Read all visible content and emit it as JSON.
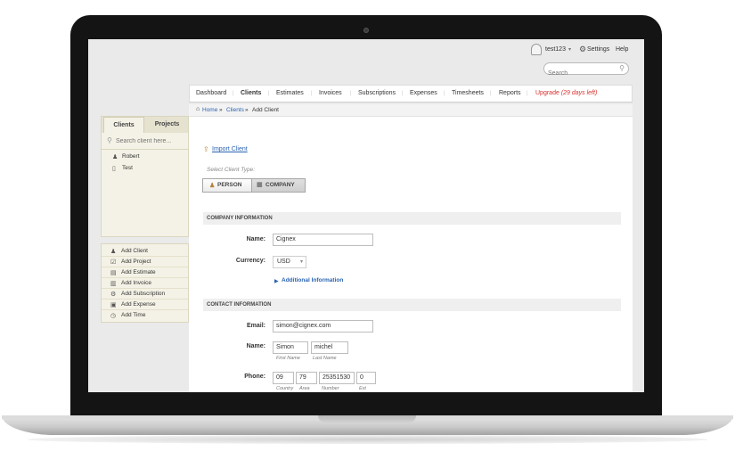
{
  "header": {
    "username": "test123",
    "settings_label": "Settings",
    "help_label": "Help",
    "search_placeholder": "Search"
  },
  "nav": {
    "items": [
      "Dashboard",
      "Clients",
      "Estimates",
      "Invoices",
      "Subscriptions",
      "Expenses",
      "Timesheets",
      "Reports"
    ],
    "active": "Clients",
    "upgrade_label": "Upgrade",
    "upgrade_note": "(29 days left)"
  },
  "breadcrumb": {
    "home": "Home",
    "clients": "Clients",
    "current": "Add Client",
    "sep": "»"
  },
  "sidebar": {
    "tabs": [
      "Clients",
      "Projects"
    ],
    "search_placeholder": "Search client here...",
    "clients": [
      "Robert",
      "Test"
    ],
    "actions": [
      "Add Client",
      "Add Project",
      "Add Estimate",
      "Add Invoice",
      "Add Subscription",
      "Add Expense",
      "Add Time"
    ]
  },
  "form": {
    "import_label": "Import Client",
    "client_type_label": "Select Client Type:",
    "type_person": "PERSON",
    "type_company": "COMPANY",
    "company_section": "COMPANY INFORMATION",
    "name_label": "Name:",
    "company_name": "Cignex",
    "currency_label": "Currency:",
    "currency_value": "USD",
    "additional_info": "Additional Information",
    "contact_section": "CONTACT INFORMATION",
    "email_label": "Email:",
    "email_value": "simon@cignex.com",
    "contact_name_label": "Name:",
    "first_name": "Simon",
    "last_name": "michel",
    "first_name_hint": "First Name",
    "last_name_hint": "Last Name",
    "phone_label": "Phone:",
    "phone_country": "09",
    "phone_area": "79",
    "phone_number": "25351530",
    "phone_ext": "0",
    "hint_country": "Country",
    "hint_area": "Area",
    "hint_number": "Number",
    "hint_ext": "Ext"
  }
}
